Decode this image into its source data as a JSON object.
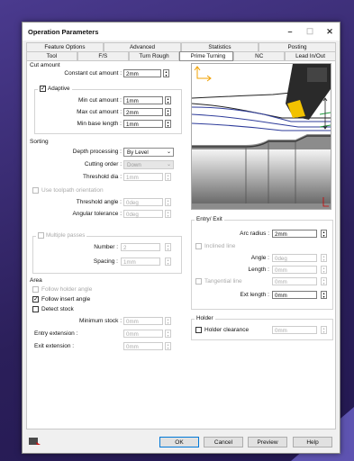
{
  "window": {
    "title": "Operation Parameters",
    "minimize": "–",
    "maximize": "☐",
    "close": "✕"
  },
  "tabs": {
    "row1": [
      "Feature Options",
      "Advanced",
      "Statistics",
      "Posting"
    ],
    "row2": [
      "Tool",
      "F/S",
      "Turn Rough",
      "Prime Turning",
      "NC",
      "Lead In/Out"
    ],
    "selected": "Prime Turning"
  },
  "cut_amount": {
    "title": "Cut amount",
    "constant_label": "Constant cut amount :",
    "constant_value": "2mm",
    "adaptive_label": "Adaptive",
    "adaptive_checked": "✓",
    "min_label": "Min cut amount :",
    "min_value": "1mm",
    "max_label": "Max cut amount :",
    "max_value": "2mm",
    "minbase_label": "Min base length :",
    "minbase_value": "1mm"
  },
  "sorting": {
    "title": "Sorting",
    "depth_label": "Depth processing :",
    "depth_value": "By Level",
    "order_label": "Cutting order :",
    "order_value": "Down",
    "threshold_label": "Threshold dia :",
    "threshold_value": "1mm",
    "use_toolpath_label": "Use toolpath orientation",
    "th_angle_label": "Threshold angle :",
    "th_angle_value": "0deg",
    "ang_tol_label": "Angular tolerance :",
    "ang_tol_value": "0deg"
  },
  "multiple_passes": {
    "title": "Multiple passes",
    "number_label": "Number :",
    "number_value": "2",
    "spacing_label": "Spacing :",
    "spacing_value": "1mm"
  },
  "area": {
    "title": "Area",
    "follow_holder_label": "Follow holder angle",
    "follow_insert_label": "Follow insert angle",
    "follow_insert_checked": "✓",
    "detect_stock_label": "Detect stock",
    "min_stock_label": "Minimum stock :",
    "min_stock_value": "0mm",
    "entry_ext_label": "Entry extension :",
    "entry_ext_value": "0mm",
    "exit_ext_label": "Exit extension :",
    "exit_ext_value": "0mm"
  },
  "entry_exit": {
    "title": "Entry/ Exit",
    "arc_label": "Arc radius :",
    "arc_value": "2mm",
    "inclined_label": "Inclined line",
    "angle_label": "Angle :",
    "angle_value": "0deg",
    "length_label": "Length :",
    "length_value": "0mm",
    "tangential_label": "Tangential line",
    "tangential_value": "0mm",
    "ext_length_label": "Ext length :",
    "ext_length_value": "0mm"
  },
  "holder": {
    "title": "Holder",
    "clearance_label": "Holder clearance",
    "clearance_value": "0mm"
  },
  "footer": {
    "ok": "OK",
    "cancel": "Cancel",
    "preview": "Preview",
    "help": "Help"
  },
  "colors": {
    "accent": "#0078d7",
    "toolpath": "#2d3b9a",
    "stock": "#3a3a3a",
    "bg": "#3a2a6e"
  }
}
